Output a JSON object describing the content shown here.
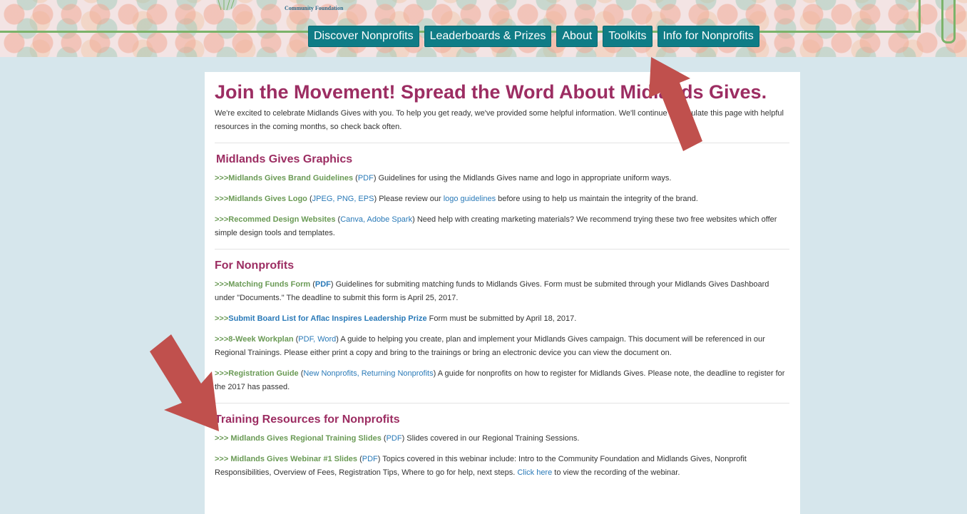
{
  "header": {
    "logo_text": "Community Foundation",
    "nav": [
      "Discover Nonprofits",
      "Leaderboards & Prizes",
      "About",
      "Toolkits",
      "Info for Nonprofits"
    ]
  },
  "page": {
    "title": "Join the Movement! Spread the Word About Midlands Gives.",
    "intro": "We're excited to celebrate Midlands Gives with you. To help you get ready, we've provided some helpful information. We'll continue to populate this page with helpful resources in the coming months, so check back often."
  },
  "graphics": {
    "title": "Midlands Gives Graphics",
    "brand": {
      "prefix": ">>>Midlands Gives Brand Guidelines",
      "link": "PDF",
      "text": "Guidelines for using the Midlands Gives name and logo in appropriate uniform ways."
    },
    "logo": {
      "prefix": ">>>Midlands Gives Logo",
      "link": "JPEG, PNG, EPS",
      "text_a": "Please review our",
      "link2": "logo guidelines",
      "text_b": "before using to help us maintain the integrity of the brand."
    },
    "design": {
      "prefix": ">>>Recommed Design Websites",
      "link": "Canva, Adobe Spark",
      "text": "Need help with creating marketing materials? We recommend trying these two free websites which offer simple design tools and templates."
    }
  },
  "nonprofits": {
    "title": "For Nonprofits",
    "matching": {
      "prefix": ">>>Matching Funds Form",
      "link": "PDF",
      "text": "Guidelines for submiting matching funds to Midlands Gives. Form must be submited through your Midlands Gives Dashboard under \"Documents.\" The deadline to submit this form is April 25, 2017."
    },
    "board": {
      "prefix": ">>>",
      "link": "Submit Board List for Aflac Inspires Leadership Prize",
      "text": "Form must be submitted by April 18, 2017."
    },
    "workplan": {
      "prefix": ">>>8-Week Workplan",
      "link": "PDF, Word",
      "text": "A guide to helping you create, plan and implement your Midlands Gives campaign. This document will be referenced in our Regional Trainings. Please either print a copy and bring to the trainings or bring an electronic device you can view the document on."
    },
    "registration": {
      "prefix": ">>>Registration Guide",
      "link": "New Nonprofits, Returning Nonprofits",
      "text": "A guide for nonprofits on how to register for Midlands Gives. Please note, the deadline to register for the 2017 has passed."
    }
  },
  "training": {
    "title": "Training Resources for Nonprofits",
    "slides": {
      "prefix": ">>> Midlands Gives Regional Training Slides",
      "link": "PDF",
      "text": "Slides covered in our Regional Training Sessions."
    },
    "webinar": {
      "prefix": ">>> Midlands Gives Webinar #1 Slides",
      "link": "PDF",
      "text_a": "Topics covered in this webinar include: Intro to the Community Foundation and Midlands Gives, Nonprofit Responsibilities, Overview of Fees, Registration Tips, Where to go for help, next steps.",
      "link2": "Click here",
      "text_b": "to view the recording of the webinar."
    }
  },
  "colors": {
    "accent": "#9c2d62",
    "nav": "#0f7c86",
    "link": "#2a7ab8",
    "prefix": "#6a9a55",
    "arrow": "#c0504d"
  }
}
